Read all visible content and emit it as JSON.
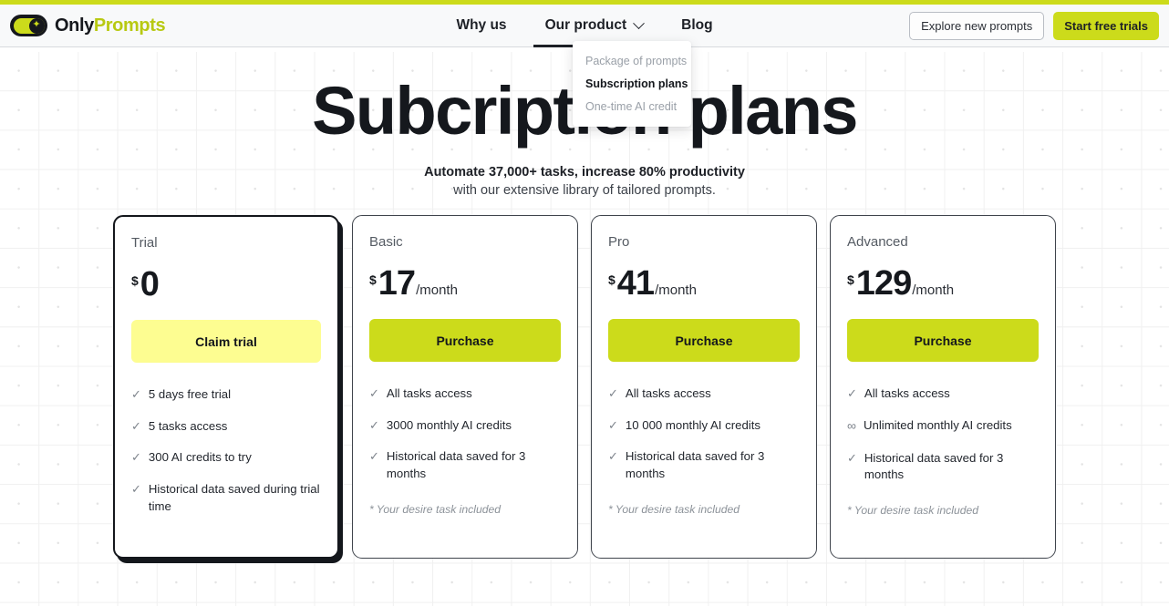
{
  "brand": {
    "name_part1": "Only",
    "name_part2": "Prompts",
    "logo_icon": "toggle-switch-icon",
    "accent_color": "#ccdb1b"
  },
  "nav": {
    "items": [
      {
        "label": "Why us",
        "active": false,
        "has_chevron": false
      },
      {
        "label": "Our product",
        "active": true,
        "has_chevron": true
      },
      {
        "label": "Blog",
        "active": false,
        "has_chevron": false
      }
    ],
    "dropdown": {
      "items": [
        {
          "label": "Package of prompts",
          "active": false
        },
        {
          "label": "Subscription plans",
          "active": true
        },
        {
          "label": "One-time AI credit",
          "active": false
        }
      ]
    }
  },
  "header_actions": {
    "explore_label": "Explore new prompts",
    "start_trial_label": "Start free trials"
  },
  "hero": {
    "title": "Subcription plans",
    "subtitle_bold": "Automate 37,000+ tasks, increase 80% productivity",
    "subtitle_light": "with our extensive library of tailored prompts."
  },
  "plans": [
    {
      "name": "Trial",
      "currency": "$",
      "amount": "0",
      "period": "",
      "cta_label": "Claim trial",
      "cta_style": "pale",
      "featured": true,
      "features": [
        {
          "mark": "check",
          "text": "5 days free trial"
        },
        {
          "mark": "check",
          "text": "5 tasks access"
        },
        {
          "mark": "check",
          "text": "300 AI credits to try"
        },
        {
          "mark": "check",
          "text": "Historical data saved during trial time"
        }
      ],
      "footnote": ""
    },
    {
      "name": "Basic",
      "currency": "$",
      "amount": "17",
      "period": "/month",
      "cta_label": "Purchase",
      "cta_style": "lime",
      "featured": false,
      "features": [
        {
          "mark": "check",
          "text": "All tasks access"
        },
        {
          "mark": "check",
          "text": "3000 monthly AI credits"
        },
        {
          "mark": "check",
          "text": "Historical data saved for 3 months"
        }
      ],
      "footnote": "* Your desire task included"
    },
    {
      "name": "Pro",
      "currency": "$",
      "amount": "41",
      "period": "/month",
      "cta_label": "Purchase",
      "cta_style": "lime",
      "featured": false,
      "features": [
        {
          "mark": "check",
          "text": "All tasks access"
        },
        {
          "mark": "check",
          "text": "10 000 monthly AI credits"
        },
        {
          "mark": "check",
          "text": "Historical data saved for 3 months"
        }
      ],
      "footnote": "* Your desire task included"
    },
    {
      "name": "Advanced",
      "currency": "$",
      "amount": "129",
      "period": "/month",
      "cta_label": "Purchase",
      "cta_style": "lime",
      "featured": false,
      "features": [
        {
          "mark": "check",
          "text": "All tasks access"
        },
        {
          "mark": "infinity",
          "text": "Unlimited monthly AI credits"
        },
        {
          "mark": "check",
          "text": "Historical data saved for 3 months"
        }
      ],
      "footnote": "* Your desire task included"
    }
  ]
}
